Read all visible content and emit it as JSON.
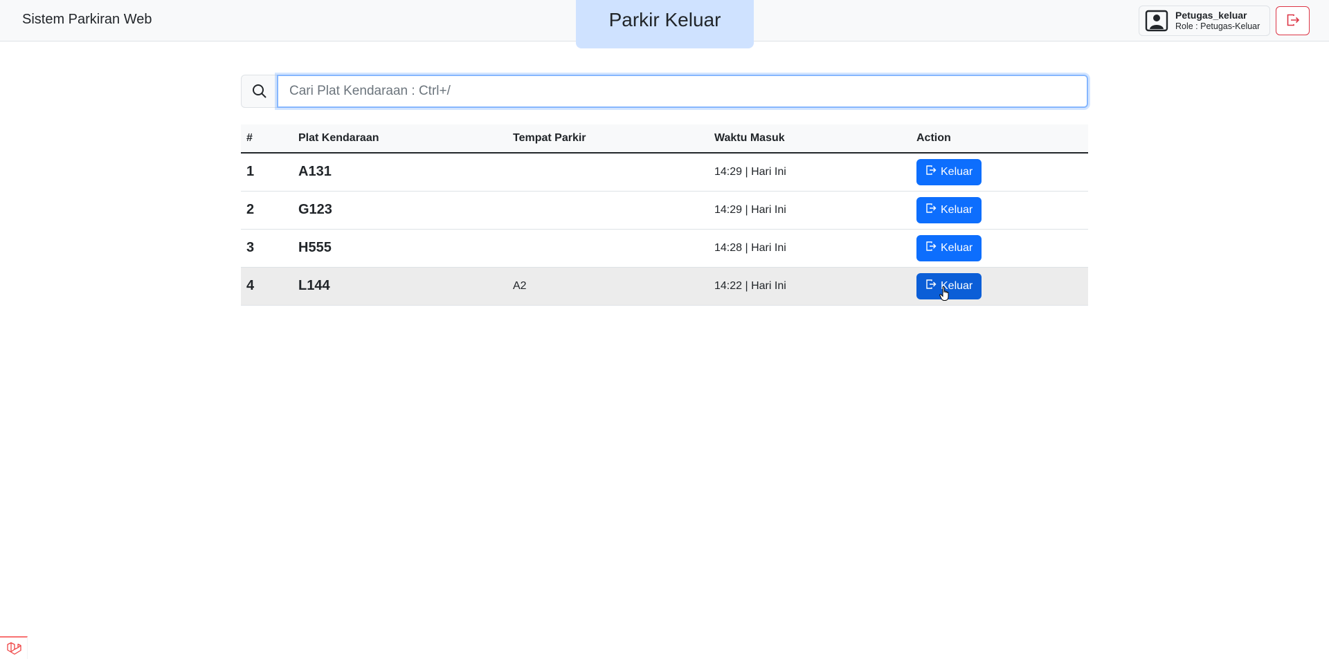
{
  "app": {
    "brand": "Sistem Parkiran Web",
    "page_title": "Parkir Keluar"
  },
  "user": {
    "name": "Petugas_keluar",
    "role": "Role : Petugas-Keluar",
    "avatar_icon": "user-portrait-icon",
    "logout_icon": "logout-icon",
    "logout_color": "#dc3545"
  },
  "search": {
    "icon": "search-icon",
    "placeholder": "Cari Plat Kendaraan : Ctrl+/",
    "value": ""
  },
  "table": {
    "headers": {
      "num": "#",
      "plat": "Plat Kendaraan",
      "tempat": "Tempat Parkir",
      "waktu": "Waktu Masuk",
      "action": "Action"
    },
    "rows": [
      {
        "num": "1",
        "plat": "A131",
        "tempat": "",
        "waktu": "14:29 | Hari Ini",
        "action": "Keluar"
      },
      {
        "num": "2",
        "plat": "G123",
        "tempat": "",
        "waktu": "14:29 | Hari Ini",
        "action": "Keluar"
      },
      {
        "num": "3",
        "plat": "H555",
        "tempat": "",
        "waktu": "14:28 | Hari Ini",
        "action": "Keluar"
      },
      {
        "num": "4",
        "plat": "L144",
        "tempat": "A2",
        "waktu": "14:22 | Hari Ini",
        "action": "Keluar"
      }
    ]
  },
  "colors": {
    "primary": "#0d6efd",
    "title_tab_bg": "#cfe2ff",
    "danger": "#dc3545"
  }
}
